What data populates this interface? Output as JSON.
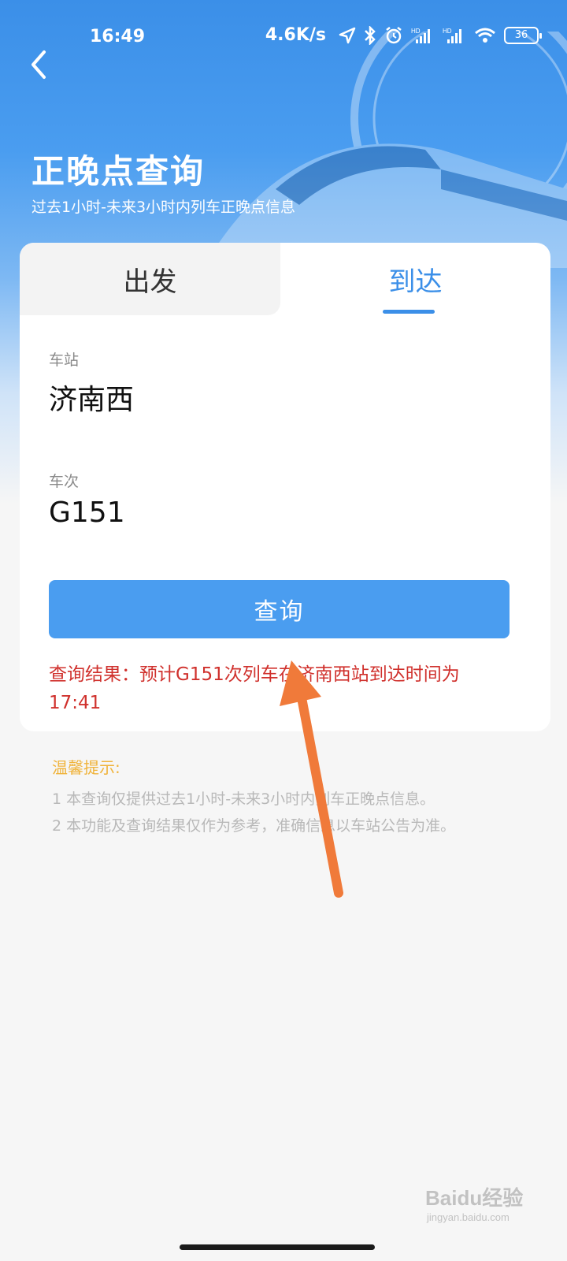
{
  "status_bar": {
    "time": "16:49",
    "speed": "4.6K/s",
    "battery": "36",
    "icons": [
      "location-icon",
      "bluetooth-icon",
      "alarm-icon",
      "signal-icon",
      "signal-icon",
      "wifi-icon",
      "battery-icon"
    ]
  },
  "header": {
    "title": "正晚点查询",
    "subtitle": "过去1小时-未来3小时内列车正晚点信息"
  },
  "tabs": {
    "depart_label": "出发",
    "arrive_label": "到达",
    "active": "arrive"
  },
  "form": {
    "station_label": "车站",
    "station_value": "济南西",
    "train_label": "车次",
    "train_value": "G151"
  },
  "query_button_label": "查询",
  "result_text": "查询结果：预计G151次列车在济南西站到达时间为17:41",
  "tips": {
    "title": "温馨提示:",
    "lines": [
      "1 本查询仅提供过去1小时-未来3小时内列车正晚点信息。",
      "2 本功能及查询结果仅作为参考，准确信息以车站公告为准。"
    ]
  },
  "watermark": {
    "brand": "Baidu经验",
    "url": "jingyan.baidu.com"
  },
  "colors": {
    "accent": "#3b8fe8",
    "button": "#4a9df0",
    "result": "#d0312d",
    "tips_title": "#f0b33a",
    "arrow": "#f07a3a"
  }
}
